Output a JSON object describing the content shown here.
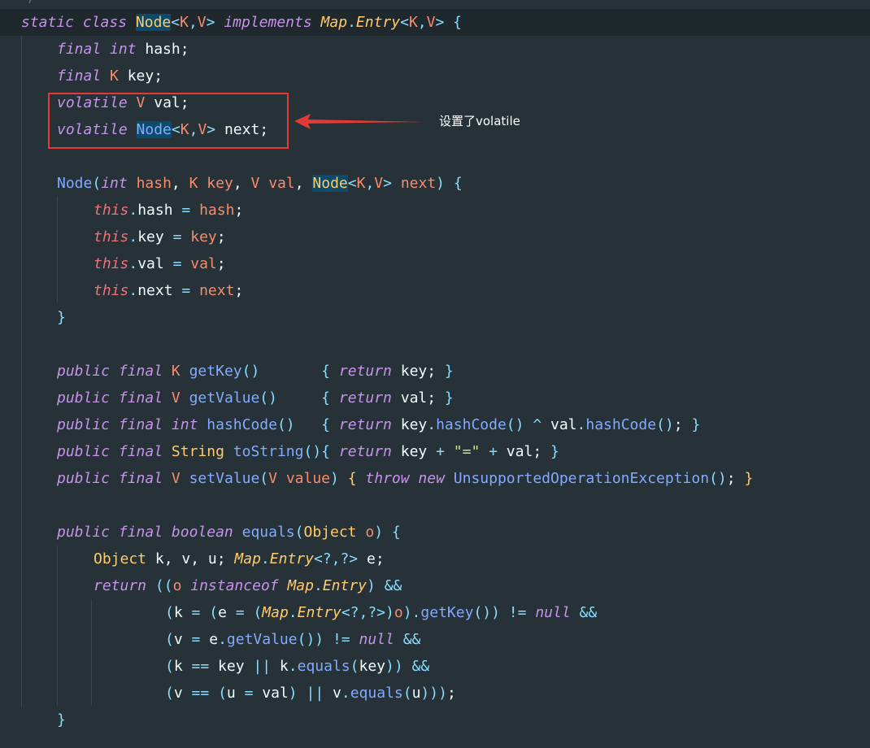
{
  "editor": {
    "top_clip": "*/",
    "code_lines": [
      [
        [
          "kw",
          "static"
        ],
        [
          "",
          " "
        ],
        [
          "kw",
          "class"
        ],
        [
          "",
          " "
        ],
        [
          "ty hl",
          "Node"
        ],
        [
          "op",
          "<"
        ],
        [
          "tp",
          "K"
        ],
        [
          "op",
          ","
        ],
        [
          "tp",
          "V"
        ],
        [
          "op",
          ">"
        ],
        [
          "",
          " "
        ],
        [
          "kw",
          "implements"
        ],
        [
          "",
          " "
        ],
        [
          "tyi",
          "Map"
        ],
        [
          "op",
          "."
        ],
        [
          "tyi",
          "Entry"
        ],
        [
          "op",
          "<"
        ],
        [
          "tp",
          "K"
        ],
        [
          "op",
          ","
        ],
        [
          "tp",
          "V"
        ],
        [
          "op",
          ">"
        ],
        [
          "",
          " "
        ],
        [
          "br",
          "{"
        ]
      ],
      [
        [
          "kw",
          "final"
        ],
        [
          "",
          " "
        ],
        [
          "kw",
          "int"
        ],
        [
          "",
          " hash;"
        ]
      ],
      [
        [
          "kw",
          "final"
        ],
        [
          "",
          " "
        ],
        [
          "tp",
          "K"
        ],
        [
          "",
          " key;"
        ]
      ],
      [
        [
          "kw",
          "volatile"
        ],
        [
          "",
          " "
        ],
        [
          "tp",
          "V"
        ],
        [
          "",
          " val;"
        ]
      ],
      [
        [
          "kw",
          "volatile"
        ],
        [
          "",
          " "
        ],
        [
          "fn hl",
          "Node"
        ],
        [
          "op",
          "<"
        ],
        [
          "tp",
          "K"
        ],
        [
          "op",
          ","
        ],
        [
          "tp",
          "V"
        ],
        [
          "op",
          ">"
        ],
        [
          "",
          " next;"
        ]
      ],
      [],
      [
        [
          "fn",
          "Node"
        ],
        [
          "br",
          "("
        ],
        [
          "kw",
          "int"
        ],
        [
          "",
          " "
        ],
        [
          "par",
          "hash"
        ],
        [
          "",
          ", "
        ],
        [
          "tp",
          "K"
        ],
        [
          "",
          " "
        ],
        [
          "par",
          "key"
        ],
        [
          "",
          ", "
        ],
        [
          "tp",
          "V"
        ],
        [
          "",
          " "
        ],
        [
          "par",
          "val"
        ],
        [
          "",
          ", "
        ],
        [
          "ty hl",
          "Node"
        ],
        [
          "op",
          "<"
        ],
        [
          "tp",
          "K"
        ],
        [
          "op",
          ","
        ],
        [
          "tp",
          "V"
        ],
        [
          "op",
          ">"
        ],
        [
          "",
          " "
        ],
        [
          "par",
          "next"
        ],
        [
          "br",
          ")"
        ],
        [
          "",
          " "
        ],
        [
          "br",
          "{"
        ]
      ],
      [
        [
          "red",
          "this"
        ],
        [
          "op",
          "."
        ],
        [
          "",
          "hash "
        ],
        [
          "op",
          "="
        ],
        [
          "",
          " "
        ],
        [
          "par",
          "hash"
        ],
        [
          "",
          ";"
        ]
      ],
      [
        [
          "red",
          "this"
        ],
        [
          "op",
          "."
        ],
        [
          "",
          "key "
        ],
        [
          "op",
          "="
        ],
        [
          "",
          " "
        ],
        [
          "par",
          "key"
        ],
        [
          "",
          ";"
        ]
      ],
      [
        [
          "red",
          "this"
        ],
        [
          "op",
          "."
        ],
        [
          "",
          "val "
        ],
        [
          "op",
          "="
        ],
        [
          "",
          " "
        ],
        [
          "par",
          "val"
        ],
        [
          "",
          ";"
        ]
      ],
      [
        [
          "red",
          "this"
        ],
        [
          "op",
          "."
        ],
        [
          "",
          "next "
        ],
        [
          "op",
          "="
        ],
        [
          "",
          " "
        ],
        [
          "par",
          "next"
        ],
        [
          "",
          ";"
        ]
      ],
      [
        [
          "br",
          "}"
        ]
      ],
      [],
      [
        [
          "kw",
          "public"
        ],
        [
          "",
          " "
        ],
        [
          "kw",
          "final"
        ],
        [
          "",
          " "
        ],
        [
          "tp",
          "K"
        ],
        [
          "",
          " "
        ],
        [
          "fn",
          "getKey"
        ],
        [
          "br",
          "()"
        ],
        [
          "",
          "       "
        ],
        [
          "br",
          "{"
        ],
        [
          "",
          " "
        ],
        [
          "kwr",
          "return"
        ],
        [
          "",
          " key; "
        ],
        [
          "br",
          "}"
        ]
      ],
      [
        [
          "kw",
          "public"
        ],
        [
          "",
          " "
        ],
        [
          "kw",
          "final"
        ],
        [
          "",
          " "
        ],
        [
          "tp",
          "V"
        ],
        [
          "",
          " "
        ],
        [
          "fn",
          "getValue"
        ],
        [
          "br",
          "()"
        ],
        [
          "",
          "     "
        ],
        [
          "br",
          "{"
        ],
        [
          "",
          " "
        ],
        [
          "kwr",
          "return"
        ],
        [
          "",
          " val; "
        ],
        [
          "br",
          "}"
        ]
      ],
      [
        [
          "kw",
          "public"
        ],
        [
          "",
          " "
        ],
        [
          "kw",
          "final"
        ],
        [
          "",
          " "
        ],
        [
          "kw",
          "int"
        ],
        [
          "",
          " "
        ],
        [
          "fn",
          "hashCode"
        ],
        [
          "br",
          "()"
        ],
        [
          "",
          "   "
        ],
        [
          "br",
          "{"
        ],
        [
          "",
          " "
        ],
        [
          "kwr",
          "return"
        ],
        [
          "",
          " key"
        ],
        [
          "op",
          "."
        ],
        [
          "fn",
          "hashCode"
        ],
        [
          "br",
          "()"
        ],
        [
          "",
          " "
        ],
        [
          "op",
          "^"
        ],
        [
          "",
          " val"
        ],
        [
          "op",
          "."
        ],
        [
          "fn",
          "hashCode"
        ],
        [
          "br",
          "()"
        ],
        [
          "",
          "; "
        ],
        [
          "br",
          "}"
        ]
      ],
      [
        [
          "kw",
          "public"
        ],
        [
          "",
          " "
        ],
        [
          "kw",
          "final"
        ],
        [
          "",
          " "
        ],
        [
          "ty",
          "String"
        ],
        [
          "",
          " "
        ],
        [
          "fn",
          "toString"
        ],
        [
          "br",
          "()"
        ],
        [
          "br",
          "{"
        ],
        [
          "",
          " "
        ],
        [
          "kwr",
          "return"
        ],
        [
          "",
          " key "
        ],
        [
          "op",
          "+"
        ],
        [
          "",
          " "
        ],
        [
          "str",
          "\"=\""
        ],
        [
          "",
          " "
        ],
        [
          "op",
          "+"
        ],
        [
          "",
          " val; "
        ],
        [
          "br",
          "}"
        ]
      ],
      [
        [
          "kw",
          "public"
        ],
        [
          "",
          " "
        ],
        [
          "kw",
          "final"
        ],
        [
          "",
          " "
        ],
        [
          "tp",
          "V"
        ],
        [
          "",
          " "
        ],
        [
          "fn",
          "setValue"
        ],
        [
          "br",
          "("
        ],
        [
          "tp",
          "V"
        ],
        [
          "",
          " "
        ],
        [
          "par",
          "value"
        ],
        [
          "br",
          ")"
        ],
        [
          "",
          " "
        ],
        [
          "brg",
          "{"
        ],
        [
          "",
          " "
        ],
        [
          "kwr",
          "throw"
        ],
        [
          "",
          " "
        ],
        [
          "kwr",
          "new"
        ],
        [
          "",
          " "
        ],
        [
          "fn",
          "UnsupportedOperationException"
        ],
        [
          "br",
          "()"
        ],
        [
          "",
          "; "
        ],
        [
          "brg",
          "}"
        ]
      ],
      [],
      [
        [
          "kw",
          "public"
        ],
        [
          "",
          " "
        ],
        [
          "kw",
          "final"
        ],
        [
          "",
          " "
        ],
        [
          "kw",
          "boolean"
        ],
        [
          "",
          " "
        ],
        [
          "fn",
          "equals"
        ],
        [
          "br",
          "("
        ],
        [
          "ty",
          "Object"
        ],
        [
          "",
          " "
        ],
        [
          "par",
          "o"
        ],
        [
          "br",
          ")"
        ],
        [
          "",
          " "
        ],
        [
          "br",
          "{"
        ]
      ],
      [
        [
          "ty",
          "Object"
        ],
        [
          "",
          " k, v, u; "
        ],
        [
          "tyi",
          "Map"
        ],
        [
          "op",
          "."
        ],
        [
          "tyi",
          "Entry"
        ],
        [
          "op",
          "<?,?>"
        ],
        [
          "",
          " e;"
        ]
      ],
      [
        [
          "kwr",
          "return"
        ],
        [
          "",
          " "
        ],
        [
          "br",
          "(("
        ],
        [
          "par",
          "o"
        ],
        [
          "",
          " "
        ],
        [
          "kwr",
          "instanceof"
        ],
        [
          "",
          " "
        ],
        [
          "tyi",
          "Map"
        ],
        [
          "op",
          "."
        ],
        [
          "tyi",
          "Entry"
        ],
        [
          "br",
          ")"
        ],
        [
          "",
          " "
        ],
        [
          "op",
          "&&"
        ]
      ],
      [
        [
          "br",
          "("
        ],
        [
          "",
          "k "
        ],
        [
          "op",
          "="
        ],
        [
          "",
          " "
        ],
        [
          "br",
          "("
        ],
        [
          "",
          "e "
        ],
        [
          "op",
          "="
        ],
        [
          "",
          " "
        ],
        [
          "br",
          "("
        ],
        [
          "tyi",
          "Map"
        ],
        [
          "op",
          "."
        ],
        [
          "tyi",
          "Entry"
        ],
        [
          "op",
          "<?,?>"
        ],
        [
          "br",
          ")"
        ],
        [
          "par",
          "o"
        ],
        [
          "br",
          ")"
        ],
        [
          "op",
          "."
        ],
        [
          "fn",
          "getKey"
        ],
        [
          "br",
          "())"
        ],
        [
          "",
          " "
        ],
        [
          "op",
          "!="
        ],
        [
          "",
          " "
        ],
        [
          "kwr",
          "null"
        ],
        [
          "",
          " "
        ],
        [
          "op",
          "&&"
        ]
      ],
      [
        [
          "br",
          "("
        ],
        [
          "",
          "v "
        ],
        [
          "op",
          "="
        ],
        [
          "",
          " e"
        ],
        [
          "op",
          "."
        ],
        [
          "fn",
          "getValue"
        ],
        [
          "br",
          "())"
        ],
        [
          "",
          " "
        ],
        [
          "op",
          "!="
        ],
        [
          "",
          " "
        ],
        [
          "kwr",
          "null"
        ],
        [
          "",
          " "
        ],
        [
          "op",
          "&&"
        ]
      ],
      [
        [
          "br",
          "("
        ],
        [
          "",
          "k "
        ],
        [
          "op",
          "=="
        ],
        [
          "",
          " key "
        ],
        [
          "op",
          "||"
        ],
        [
          "",
          " k"
        ],
        [
          "op",
          "."
        ],
        [
          "fn",
          "equals"
        ],
        [
          "br",
          "("
        ],
        [
          "",
          "key"
        ],
        [
          "br",
          "))"
        ],
        [
          "",
          " "
        ],
        [
          "op",
          "&&"
        ]
      ],
      [
        [
          "br",
          "("
        ],
        [
          "",
          "v "
        ],
        [
          "op",
          "=="
        ],
        [
          "",
          " "
        ],
        [
          "br",
          "("
        ],
        [
          "",
          "u "
        ],
        [
          "op",
          "="
        ],
        [
          "",
          " val"
        ],
        [
          "br",
          ")"
        ],
        [
          "",
          " "
        ],
        [
          "op",
          "||"
        ],
        [
          "",
          " v"
        ],
        [
          "op",
          "."
        ],
        [
          "fn",
          "equals"
        ],
        [
          "br",
          "("
        ],
        [
          "",
          "u"
        ],
        [
          "br",
          ")))"
        ],
        [
          "",
          ";"
        ]
      ],
      [
        [
          "br",
          "}"
        ]
      ]
    ]
  },
  "annotation": {
    "label": "设置了volatile",
    "color": "#e53935"
  },
  "theme": {
    "background": "#263238",
    "current_line": "#1e282d",
    "keyword": "#c792ea",
    "type": "#ffcb6b",
    "function": "#82aaff",
    "param": "#f78c6c",
    "operator": "#89ddff",
    "string": "#c3e88d",
    "this": "#f07178"
  }
}
